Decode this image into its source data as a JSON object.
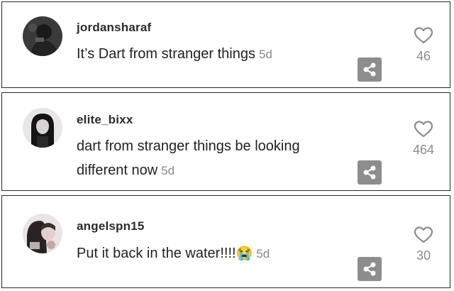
{
  "comments": [
    {
      "username": "jordansharaf",
      "text": "It’s Dart from stranger things",
      "age": "5d",
      "likes": "46",
      "avatar_icon": "avatar-dark-icon"
    },
    {
      "username": "elite_bixx",
      "text_line1": "dart from stranger things be looking",
      "text_line2": "different now",
      "age": "5d",
      "likes": "464",
      "avatar_icon": "avatar-girl-icon"
    },
    {
      "username": "angelspn15",
      "text": "Put it back in the water!!!!",
      "emoji": "😭",
      "age": "5d",
      "likes": "30",
      "avatar_icon": "avatar-photo-icon"
    }
  ],
  "icons": {
    "like": "heart-outline-icon",
    "share": "share-icon"
  },
  "colors": {
    "card_border": "#2a2a2a",
    "meta_gray": "#8a8a8a",
    "share_bg": "#8d8d8d"
  }
}
